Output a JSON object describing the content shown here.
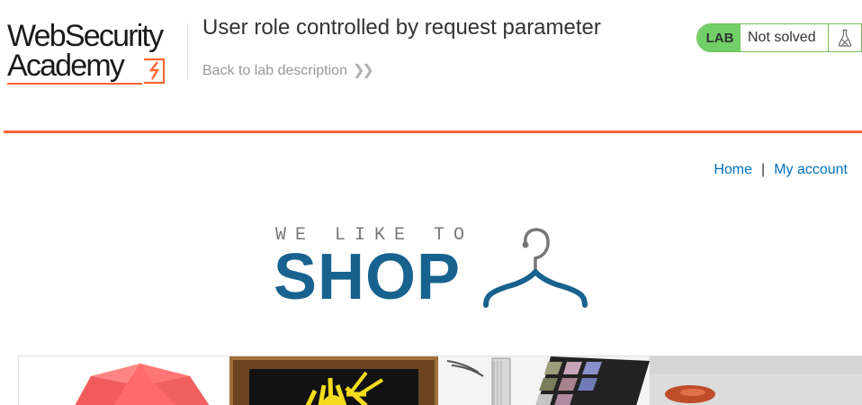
{
  "header": {
    "logo_line1": "WebSecurity",
    "logo_line2": "Academy",
    "lab_title": "User role controlled by request parameter",
    "back_link": "Back to lab description",
    "back_chevron": "»",
    "status_badge": "LAB",
    "status_text": "Not solved"
  },
  "nav": {
    "home": "Home",
    "separator": "|",
    "my_account": "My account"
  },
  "shop_logo": {
    "tagline": "WE LIKE TO",
    "word": "SHOP"
  },
  "colors": {
    "accent_orange": "#ff6633",
    "link_blue": "#0071bc",
    "status_green": "#70d067",
    "shop_blue": "#17628f"
  },
  "icons": [
    "flask-icon",
    "hanger-icon",
    "lightning-icon",
    "chevron-right-icon"
  ],
  "products": [
    {
      "name": "product-image-1"
    },
    {
      "name": "product-image-2"
    },
    {
      "name": "product-image-3"
    },
    {
      "name": "product-image-4"
    }
  ]
}
